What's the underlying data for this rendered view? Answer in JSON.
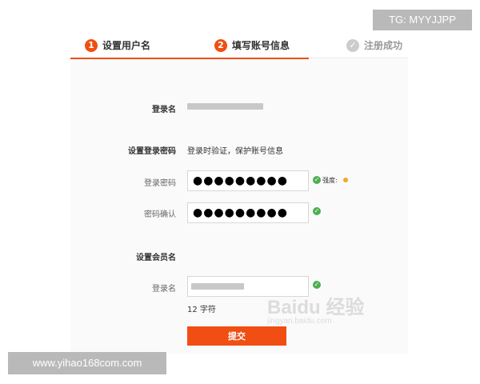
{
  "steps": [
    {
      "num": "1",
      "label": "设置用户名"
    },
    {
      "num": "2",
      "label": "填写账号信息"
    },
    {
      "label": "注册成功"
    }
  ],
  "form": {
    "username_label": "登录名",
    "password_section_label": "设置登录密码",
    "password_hint": "登录时验证，保护账号信息",
    "password_label": "登录密码",
    "password_value": "●●●●●●●●●",
    "strength_label": "强度:",
    "confirm_label": "密码确认",
    "confirm_value": "●●●●●●●●●",
    "member_section_label": "设置会员名",
    "member_label": "登录名",
    "char_count": "12 字符",
    "submit_label": "提交"
  },
  "watermarks": {
    "tg": "TG: MYYJJPP",
    "site": "www.yihao168com.com",
    "baidu_logo": "Baidu 经验",
    "baidu_url": "jingyan.baidu.com"
  },
  "colors": {
    "accent": "#f04e12",
    "success": "#4caf50",
    "strength": "#f5a623"
  }
}
